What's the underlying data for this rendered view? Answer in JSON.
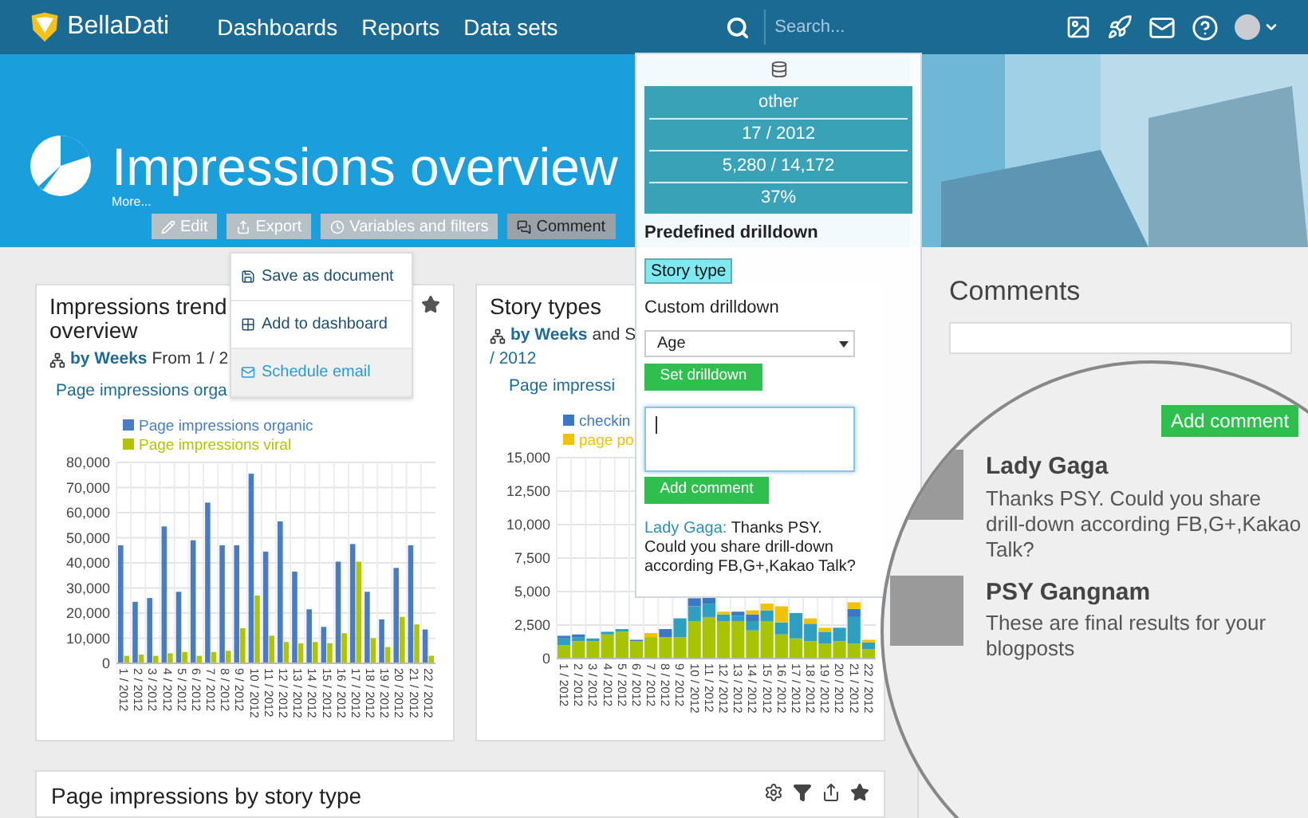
{
  "top_bar": {
    "brand": "BellaDati",
    "nav": [
      {
        "label": "Dashboards"
      },
      {
        "label": "Reports"
      },
      {
        "label": "Data sets"
      }
    ],
    "search": {
      "placeholder": "Search..."
    }
  },
  "header": {
    "title": "Impressions overview",
    "more": "More...",
    "toolbar": [
      {
        "label": "Edit",
        "selected": false
      },
      {
        "label": "Export",
        "selected": false
      },
      {
        "label": "Variables and filters",
        "selected": false
      },
      {
        "label": "Comment",
        "selected": true
      }
    ]
  },
  "export_menu": {
    "items": [
      {
        "label": "Save as document",
        "selected": false
      },
      {
        "label": "Add to dashboard",
        "selected": false
      },
      {
        "label": "Schedule email",
        "selected": true
      }
    ]
  },
  "cards": [
    {
      "title_lines": [
        "Impressions trend",
        "overview"
      ],
      "drilldown": "by Weeks",
      "subtitle_rest": "From 1 / 2",
      "measure": "Page impressions orga",
      "chart_data": {
        "type": "bar",
        "stacked": false,
        "grid": true,
        "legend": true,
        "categories": [
          "1 / 2012",
          "2 / 2012",
          "3 / 2012",
          "4 / 2012",
          "5 / 2012",
          "6 / 2012",
          "7 / 2012",
          "8 / 2012",
          "9 / 2012",
          "10 / 2012",
          "11 / 2012",
          "12 / 2012",
          "13 / 2012",
          "14 / 2012",
          "15 / 2012",
          "16 / 2012",
          "17 / 2012",
          "18 / 2012",
          "19 / 2012",
          "20 / 2012",
          "21 / 2012",
          "22 / 2012"
        ],
        "ylim": [
          0,
          80000
        ],
        "yticks": [
          {
            "value": 0,
            "label": "0"
          },
          {
            "value": 10000,
            "label": "10,000"
          },
          {
            "value": 20000,
            "label": "20,000"
          },
          {
            "value": 30000,
            "label": "30,000"
          },
          {
            "value": 40000,
            "label": "40,000"
          },
          {
            "value": 50000,
            "label": "50,000"
          },
          {
            "value": 60000,
            "label": "60,000"
          },
          {
            "value": 70000,
            "label": "70,000"
          },
          {
            "value": 80000,
            "label": "80,000"
          }
        ],
        "series": [
          {
            "name": "Page impressions organic",
            "color": "#4a7cc4",
            "values": [
              47000,
              24500,
              26000,
              54500,
              28500,
              49000,
              64000,
              47000,
              47000,
              75500,
              44500,
              56500,
              36500,
              21500,
              14500,
              40500,
              47500,
              28500,
              17500,
              38000,
              47000,
              13500
            ]
          },
          {
            "name": "Page impressions viral",
            "color": "#b2c400",
            "values": [
              3000,
              3500,
              3000,
              4000,
              4500,
              3000,
              4500,
              5000,
              14000,
              27000,
              11000,
              8500,
              8000,
              8500,
              8000,
              12000,
              40500,
              10000,
              6500,
              18500,
              15500,
              3000
            ]
          }
        ]
      }
    },
    {
      "title_lines": [
        "Story types"
      ],
      "drilldown": "by Weeks",
      "subtitle_rest": "and S",
      "subtitle_line2": "/ 2012",
      "measure": "Page impressi",
      "chart_data": {
        "type": "bar",
        "stacked": true,
        "grid": true,
        "legend": true,
        "categories": [
          "1 / 2012",
          "2 / 2012",
          "3 / 2012",
          "4 / 2012",
          "5 / 2012",
          "6 / 2012",
          "7 / 2012",
          "8 / 2012",
          "9 / 2012",
          "10 / 2012",
          "11 / 2012",
          "12 / 2012",
          "13 / 2012",
          "14 / 2012",
          "15 / 2012",
          "16 / 2012",
          "17 / 2012",
          "18 / 2012",
          "19 / 2012",
          "20 / 2012",
          "21 / 2012",
          "22 / 2012"
        ],
        "ylim": [
          0,
          15000
        ],
        "yticks": [
          {
            "value": 0,
            "label": "0"
          },
          {
            "value": 2500,
            "label": "2,500"
          },
          {
            "value": 5000,
            "label": "5,000"
          },
          {
            "value": 7500,
            "label": "7,500"
          },
          {
            "value": 10000,
            "label": "10,000"
          },
          {
            "value": 12500,
            "label": "12,500"
          },
          {
            "value": 15000,
            "label": "15,000"
          }
        ],
        "series": [
          {
            "color": "#a8c400",
            "values": [
              1000,
              1300,
              1300,
              1800,
              2000,
              1300,
              1600,
              1600,
              1600,
              2800,
              3100,
              2800,
              2800,
              2100,
              2800,
              1800,
              1500,
              1300,
              1100,
              1300,
              1100,
              700
            ]
          },
          {
            "color": "#2f9fc0",
            "values": [
              500,
              300,
              200,
              200,
              200,
              0,
              0,
              0,
              1400,
              1100,
              1000,
              500,
              400,
              700,
              800,
              900,
              1900,
              1300,
              900,
              1000,
              2000,
              500
            ]
          },
          {
            "name": "checkin",
            "color": "#3b78c4",
            "values": [
              200,
              200,
              0,
              0,
              0,
              100,
              0,
              600,
              0,
              600,
              600,
              0,
              300,
              500,
              0,
              0,
              0,
              0,
              0,
              0,
              600,
              0
            ]
          },
          {
            "name": "page po",
            "color": "#f2c200",
            "values": [
              0,
              0,
              0,
              0,
              0,
              0,
              300,
              0,
              0,
              0,
              0,
              200,
              0,
              300,
              500,
              1200,
              0,
              400,
              300,
              0,
              500,
              200
            ]
          }
        ]
      }
    }
  ],
  "bottom_card": {
    "title": "Page impressions by story type"
  },
  "comments_panel": {
    "title": "Comments"
  },
  "drilldown_popup": {
    "info": [
      "other",
      "17 / 2012",
      "5,280 / 14,172",
      "37%"
    ],
    "predefined_label": "Predefined drilldown",
    "predefined": [
      {
        "label": "Story type",
        "selected": true
      }
    ],
    "custom_label": "Custom drilldown",
    "custom_select": {
      "value": "Age"
    },
    "set_button": "Set drilldown",
    "add_button": "Add comment",
    "comment": {
      "author": "Lady Gaga:",
      "text": "Thanks PSY. Could you share drill-down according FB,G+,Kakao Talk?"
    }
  },
  "magnifier": {
    "add_button": "Add comment",
    "comments": [
      {
        "author": "Lady Gaga",
        "text": "Thanks PSY. Could you share drill-down according FB,G+,Kakao Talk?"
      },
      {
        "author": "PSY Gangnam",
        "text": "These are final results for your blogposts"
      }
    ]
  }
}
